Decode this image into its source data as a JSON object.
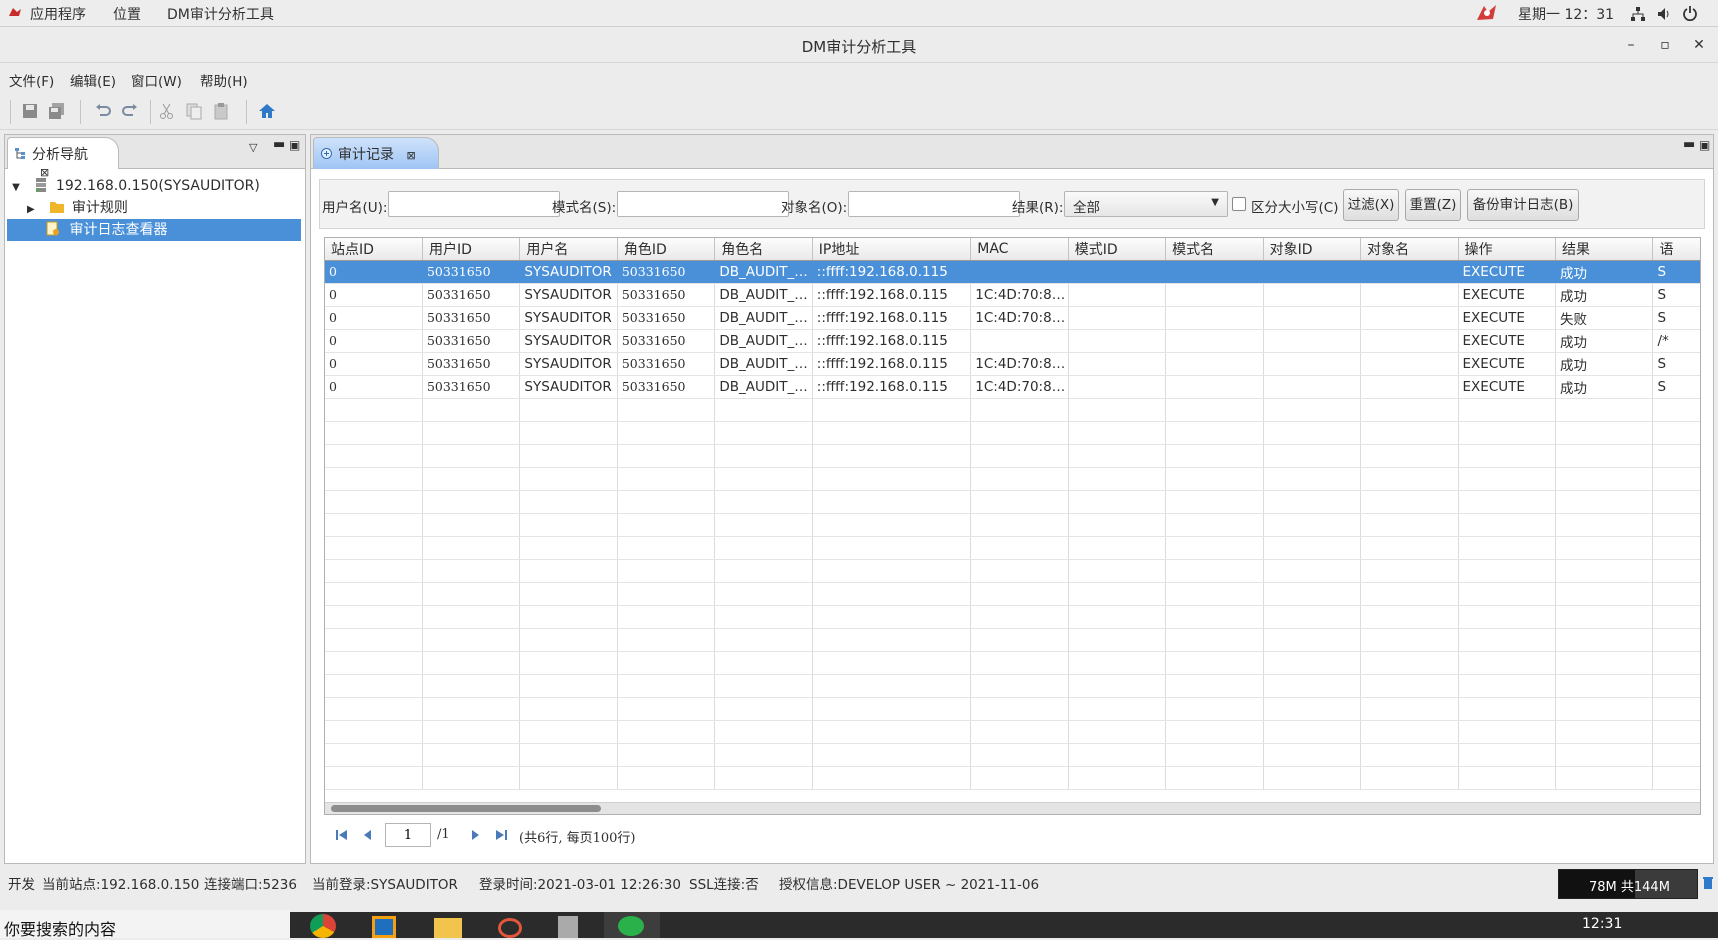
{
  "topbar": {
    "apps": "应用程序",
    "places": "位置",
    "current_app": "DM审计分析工具",
    "clock": "星期一 12：31"
  },
  "window": {
    "title": "DM审计分析工具",
    "minimize": "–",
    "maximize": "▫",
    "close": "✕"
  },
  "menubar": [
    "文件(F)",
    "编辑(E)",
    "窗口(W)",
    "帮助(H)"
  ],
  "left_panel": {
    "tab_label": "分析导航",
    "tree": {
      "root": "192.168.0.150(SYSAUDITOR)",
      "child1": "审计规则",
      "child2": "审计日志查看器"
    }
  },
  "right_panel": {
    "tab_label": "审计记录",
    "filters": {
      "username_label": "用户名(U):",
      "username_value": "",
      "schema_label": "模式名(S):",
      "schema_value": "",
      "object_label": "对象名(O):",
      "object_value": "",
      "result_label": "结果(R):",
      "result_value": "全部",
      "case_label": "区分大小写(C)",
      "case_checked": false,
      "filter_btn": "过滤(X)",
      "reset_btn": "重置(Z)",
      "backup_btn": "备份审计日志(B)"
    },
    "table": {
      "columns": [
        "站点ID",
        "用户ID",
        "用户名",
        "角色ID",
        "角色名",
        "IP地址",
        "MAC",
        "模式ID",
        "模式名",
        "对象ID",
        "对象名",
        "操作",
        "结果",
        "语"
      ],
      "rows": [
        [
          "0",
          "50331650",
          "SYSAUDITOR",
          "50331650",
          "DB_AUDIT_A...",
          "::ffff:192.168.0.115",
          "",
          "",
          "",
          "",
          "",
          "EXECUTE",
          "成功",
          "S"
        ],
        [
          "0",
          "50331650",
          "SYSAUDITOR",
          "50331650",
          "DB_AUDIT_A...",
          "::ffff:192.168.0.115",
          "1C:4D:70:82:...",
          "",
          "",
          "",
          "",
          "EXECUTE",
          "成功",
          "S"
        ],
        [
          "0",
          "50331650",
          "SYSAUDITOR",
          "50331650",
          "DB_AUDIT_A...",
          "::ffff:192.168.0.115",
          "1C:4D:70:82:...",
          "",
          "",
          "",
          "",
          "EXECUTE",
          "失败",
          "S"
        ],
        [
          "0",
          "50331650",
          "SYSAUDITOR",
          "50331650",
          "DB_AUDIT_A...",
          "::ffff:192.168.0.115",
          "",
          "",
          "",
          "",
          "",
          "EXECUTE",
          "成功",
          "/*"
        ],
        [
          "0",
          "50331650",
          "SYSAUDITOR",
          "50331650",
          "DB_AUDIT_A...",
          "::ffff:192.168.0.115",
          "1C:4D:70:82:...",
          "",
          "",
          "",
          "",
          "EXECUTE",
          "成功",
          "S"
        ],
        [
          "0",
          "50331650",
          "SYSAUDITOR",
          "50331650",
          "DB_AUDIT_A...",
          "::ffff:192.168.0.115",
          "1C:4D:70:82:...",
          "",
          "",
          "",
          "",
          "EXECUTE",
          "成功",
          "S"
        ]
      ],
      "selected_row": 0
    },
    "pager": {
      "page": "1",
      "total": "/1",
      "summary": "(共6行, 每页100行)"
    }
  },
  "statusbar": {
    "mode": "开发",
    "site": "当前站点:192.168.0.150",
    "port": "连接端口:5236",
    "login": "当前登录:SYSAUDITOR",
    "login_time": "登录时间:2021-03-01 12:26:30",
    "ssl": "SSL连接:否",
    "license": "授权信息:DEVELOP USER ~ 2021-11-06",
    "memory": "78M 共144M"
  },
  "taskbar": {
    "search_hint": "你要搜索的内容",
    "clock": "12:31"
  },
  "colors": {
    "selection": "#4a90d9",
    "tab_active": "#9fc5f4",
    "accent_home": "#2f79c9"
  }
}
